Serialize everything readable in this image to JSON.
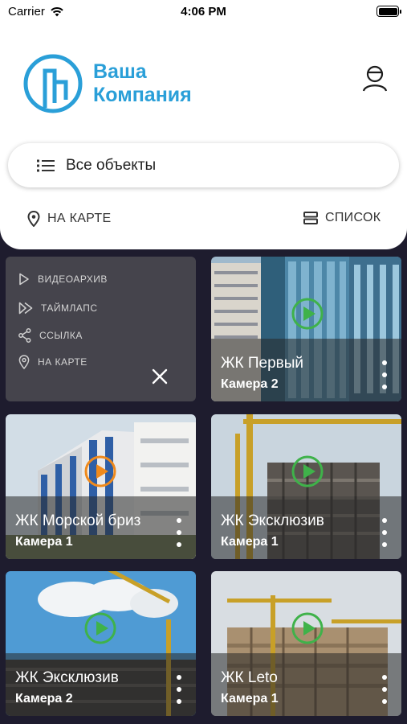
{
  "status_bar": {
    "carrier": "Carrier",
    "time": "4:06 PM"
  },
  "header": {
    "logo_line1": "Ваша",
    "logo_line2": "Компания"
  },
  "search": {
    "label": "Все объекты"
  },
  "view_toggle": {
    "map": "НА КАРТЕ",
    "list": "СПИСОК"
  },
  "context_menu": {
    "items": [
      "ВИДЕОАРХИВ",
      "ТАЙМЛАПС",
      "ССЫЛКА",
      "НА КАРТЕ"
    ]
  },
  "cards": [
    {
      "title": "ЖК Первый",
      "camera": "Камера 2",
      "play_color": "#3fb24a"
    },
    {
      "title": "ЖК Морской бриз",
      "camera": "Камера 1",
      "play_color": "#f08a1c"
    },
    {
      "title": "ЖК Эксклюзив",
      "camera": "Камера 1",
      "play_color": "#3fb24a"
    },
    {
      "title": "ЖК Эксклюзив",
      "camera": "Камера  2",
      "play_color": "#3fb24a"
    },
    {
      "title": "ЖК Leto",
      "camera": "Камера 1",
      "play_color": "#3fb24a"
    }
  ],
  "colors": {
    "brand": "#2a9fd8",
    "background": "#1e1c2e",
    "menu": "#45444c"
  }
}
